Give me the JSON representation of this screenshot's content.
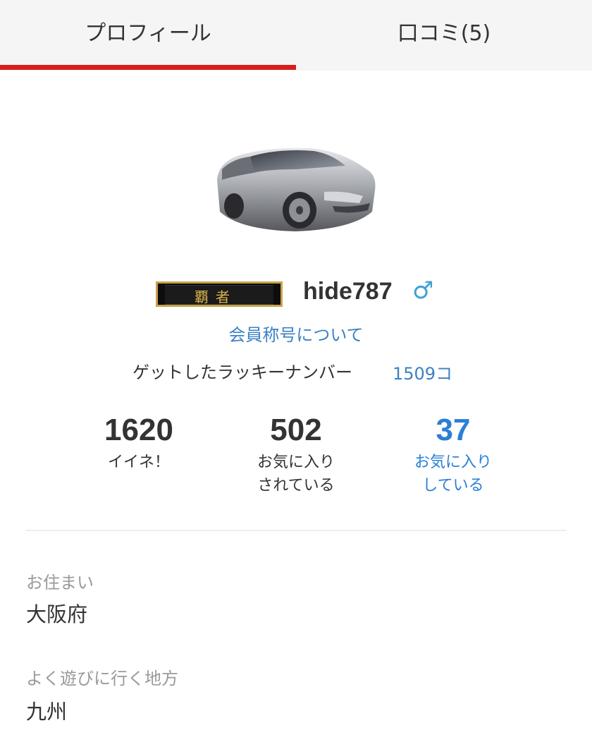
{
  "tabs": [
    {
      "label": "プロフィール",
      "active": true
    },
    {
      "label": "口コミ(5)",
      "active": false
    }
  ],
  "accent_color": "#d91c1c",
  "link_color": "#3b82c4",
  "profile": {
    "rank_badge_text": "覇者",
    "username": "hide787",
    "gender_icon": "male-icon",
    "gender_symbol": "♂",
    "rank_link": "会員称号について",
    "lucky_label": "ゲットしたラッキーナンバー",
    "lucky_value": "1509コ"
  },
  "stats": [
    {
      "value": "1620",
      "label_line1": "イイネ！",
      "label_line2": ""
    },
    {
      "value": "502",
      "label_line1": "お気に入り",
      "label_line2": "されている"
    },
    {
      "value": "37",
      "label_line1": "お気に入り",
      "label_line2": "している"
    }
  ],
  "details": [
    {
      "label": "お住まい",
      "value": "大阪府"
    },
    {
      "label": "よく遊びに行く地方",
      "value": "九州"
    }
  ]
}
